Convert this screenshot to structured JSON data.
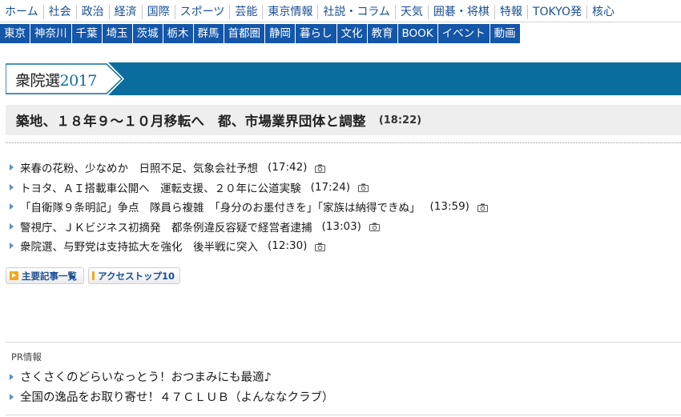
{
  "nav_primary": [
    "ホーム",
    "社会",
    "政治",
    "経済",
    "国際",
    "スポーツ",
    "芸能",
    "東京情報",
    "社説・コラム",
    "天気",
    "囲碁・将棋",
    "特報",
    "TOKYO発",
    "核心"
  ],
  "nav_secondary": [
    "東京",
    "神奈川",
    "千葉",
    "埼玉",
    "茨城",
    "栃木",
    "群馬",
    "首都圏",
    "静岡",
    "暮らし",
    "文化",
    "教育",
    "BOOK",
    "イベント",
    "動画"
  ],
  "banner": {
    "text_prefix": "衆院選",
    "year": "2017"
  },
  "headline": {
    "title": "築地、１８年９～１０月移転へ　都、市場業界団体と調整",
    "time": "(18:22)"
  },
  "news": [
    {
      "title": "来春の花粉、少なめか　日照不足、気象会社予想",
      "time": "(17:42)",
      "icon": "camera-icon"
    },
    {
      "title": "トヨタ、ＡＩ搭載車公開へ　運転支援、２０年に公道実験",
      "time": "(17:24)",
      "icon": "camera-icon"
    },
    {
      "title": "「自衛隊９条明記」争点　隊員ら複雑　「身分のお墨付きを」「家族は納得できぬ」",
      "time": "(13:59)",
      "icon": "camera-icon"
    },
    {
      "title": "警視庁、ＪＫビジネス初摘発　都条例違反容疑で経営者逮捕",
      "time": "(13:03)",
      "icon": "camera-icon"
    },
    {
      "title": "衆院選、与野党は支持拡大を強化　後半戦に突入",
      "time": "(12:30)",
      "icon": "camera-icon"
    }
  ],
  "buttons": {
    "main_articles": "主要記事一覧",
    "access_top": "アクセストップ10"
  },
  "pr": {
    "title": "PR情報",
    "items": [
      "さくさくのどらいなっとう！おつまみにも最適♪",
      "全国の逸品をお取り寄せ！４７ＣＬＵＢ（よんななクラブ）"
    ]
  },
  "colors": {
    "nav_secondary_bg": "#1456a8",
    "banner_bg": "#0b6d9e",
    "link": "#1a4f97",
    "bullet": "#5a8fd0",
    "button_icon": "#f0a81c"
  }
}
